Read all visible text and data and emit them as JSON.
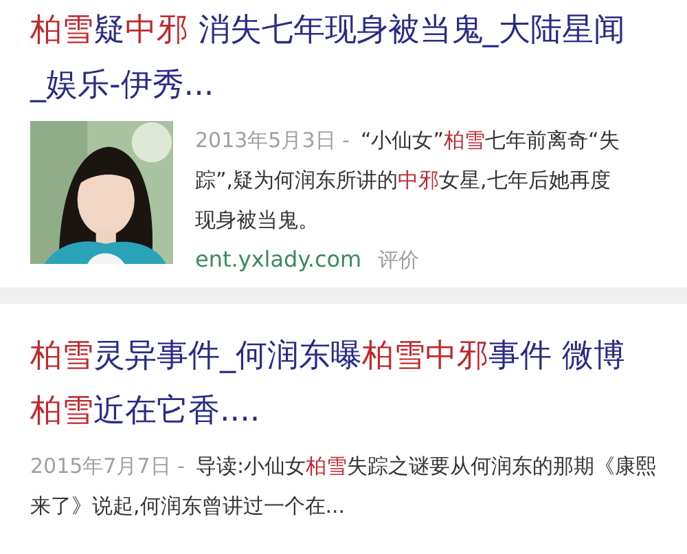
{
  "results": [
    {
      "title": "**柏雪**疑**中邪** 消失七年现身被当鬼_大陆星闻_娱乐-伊秀...",
      "date": "2013年5月3日 -",
      "snippet": "“小仙女”**柏雪**七年前离奇“失踪”,疑为何润东所讲的**中邪**女星,七年后她再度现身被当鬼。",
      "source": "ent.yxlady.com",
      "action": "评价"
    },
    {
      "title": "**柏雪**灵异事件_何润东曝**柏雪中邪**事件 微博**柏雪**近在它香....",
      "date": "2015年7月7日 -",
      "snippet": "导读:小仙女**柏雪**失踪之谜要从何润东的那期《康熙来了》说起,何润东曾讲过一个在..."
    }
  ]
}
